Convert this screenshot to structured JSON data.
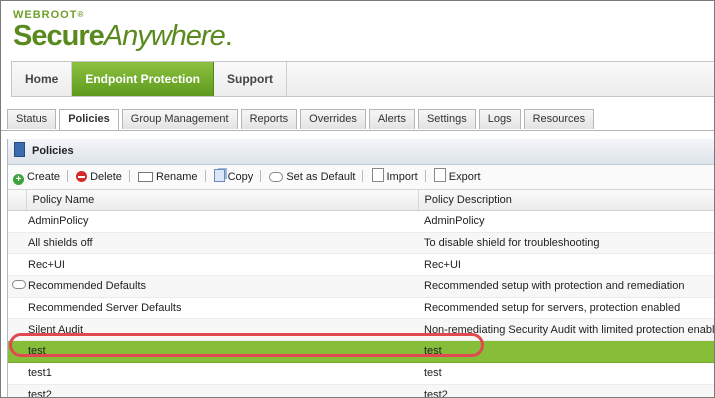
{
  "logo": {
    "brand": "WEBROOT",
    "trademark": "®",
    "product_bold": "Secure",
    "product_italic": "Anywhere",
    "dot": "."
  },
  "topnav": [
    {
      "label": "Home",
      "active": false
    },
    {
      "label": "Endpoint Protection",
      "active": true
    },
    {
      "label": "Support",
      "active": false
    }
  ],
  "subtabs": [
    {
      "label": "Status",
      "active": false
    },
    {
      "label": "Policies",
      "active": true
    },
    {
      "label": "Group Management",
      "active": false
    },
    {
      "label": "Reports",
      "active": false
    },
    {
      "label": "Overrides",
      "active": false
    },
    {
      "label": "Alerts",
      "active": false
    },
    {
      "label": "Settings",
      "active": false
    },
    {
      "label": "Logs",
      "active": false
    },
    {
      "label": "Resources",
      "active": false
    }
  ],
  "panel": {
    "title": "Policies"
  },
  "toolbar": {
    "create": "Create",
    "delete": "Delete",
    "rename": "Rename",
    "copy": "Copy",
    "set_default": "Set as Default",
    "import": "Import",
    "export": "Export"
  },
  "table": {
    "headers": {
      "name": "Policy Name",
      "description": "Policy Description"
    },
    "rows": [
      {
        "name": "AdminPolicy",
        "description": "AdminPolicy",
        "default": false,
        "selected": false
      },
      {
        "name": "All shields off",
        "description": "To disable shield for troubleshooting",
        "default": false,
        "selected": false
      },
      {
        "name": "Rec+UI",
        "description": "Rec+UI",
        "default": false,
        "selected": false
      },
      {
        "name": "Recommended Defaults",
        "description": "Recommended setup with protection and remediation",
        "default": true,
        "selected": false
      },
      {
        "name": "Recommended Server Defaults",
        "description": "Recommended setup for servers, protection enabled",
        "default": false,
        "selected": false
      },
      {
        "name": "Silent Audit",
        "description": "Non-remediating Security Audit with limited protection enabled",
        "default": false,
        "selected": false
      },
      {
        "name": "test",
        "description": "test",
        "default": false,
        "selected": true
      },
      {
        "name": "test1",
        "description": "test",
        "default": false,
        "selected": false
      },
      {
        "name": "test2",
        "description": "test2",
        "default": false,
        "selected": false
      }
    ]
  },
  "colors": {
    "accent_green": "#86be3a",
    "highlight_ring": "#e2484f",
    "logo_green": "#5a8a1e"
  }
}
